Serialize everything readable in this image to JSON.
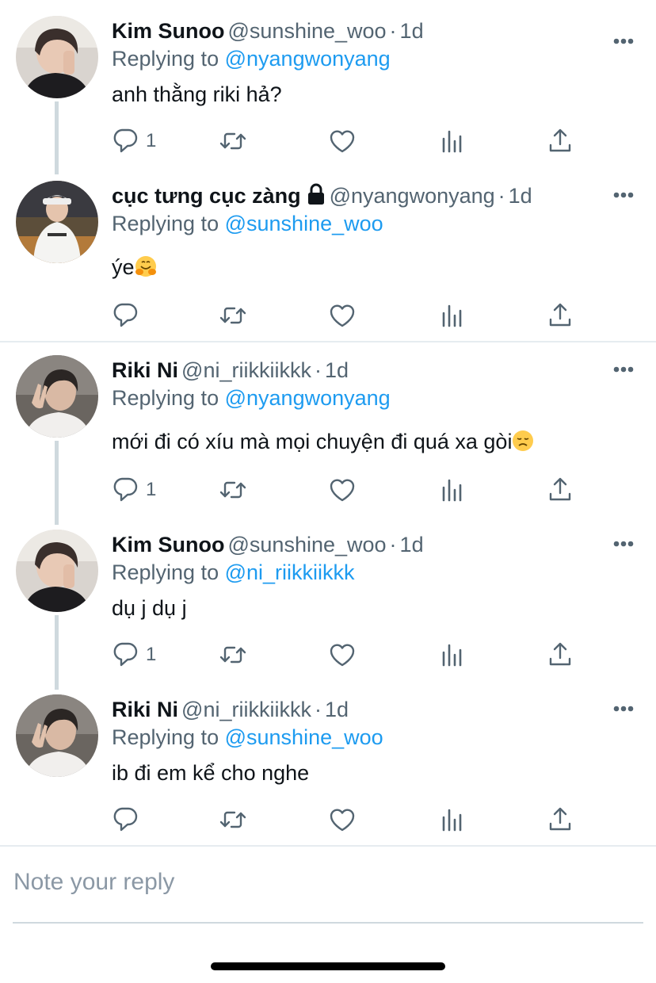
{
  "tweets": [
    {
      "name": "Kim Sunoo",
      "handle": "@sunshine_woo",
      "dot": "·",
      "time": "1d",
      "replying_prefix": "Replying to",
      "replying_handle": "@nyangwonyang",
      "text": "anh thằng riki hả?",
      "reply_count": "1"
    },
    {
      "name": "cục tưng cục zàng",
      "locked_icon": "lock-icon",
      "handle": "@nyangwonyang",
      "dot": "·",
      "time": "1d",
      "replying_prefix": "Replying to",
      "replying_handle": "@sunshine_woo",
      "text": "ýe",
      "emoji": "hugging-face",
      "reply_count": ""
    },
    {
      "name": "Riki Ni",
      "handle": "@ni_riikkiikkk",
      "dot": "·",
      "time": "1d",
      "replying_prefix": "Replying to",
      "replying_handle": "@nyangwonyang",
      "text": "mới đi có xíu mà mọi chuyện đi quá xa gòi",
      "emoji": "disappointed-face",
      "reply_count": "1"
    },
    {
      "name": "Kim Sunoo",
      "handle": "@sunshine_woo",
      "dot": "·",
      "time": "1d",
      "replying_prefix": "Replying to",
      "replying_handle": "@ni_riikkiikkk",
      "text": "dụ j dụ j",
      "reply_count": "1"
    },
    {
      "name": "Riki Ni",
      "handle": "@ni_riikkiikkk",
      "dot": "·",
      "time": "1d",
      "replying_prefix": "Replying to",
      "replying_handle": "@sunshine_woo",
      "text": "ib đi em kể cho nghe",
      "reply_count": ""
    }
  ],
  "compose": {
    "placeholder": "Note your reply"
  },
  "icons": [
    "more-icon",
    "reply-icon",
    "retweet-icon",
    "like-icon",
    "analytics-icon",
    "share-icon",
    "lock-icon"
  ],
  "colors": {
    "link": "#1d9bf0",
    "secondary_text": "#536471",
    "thread_line": "#cfd9de"
  }
}
